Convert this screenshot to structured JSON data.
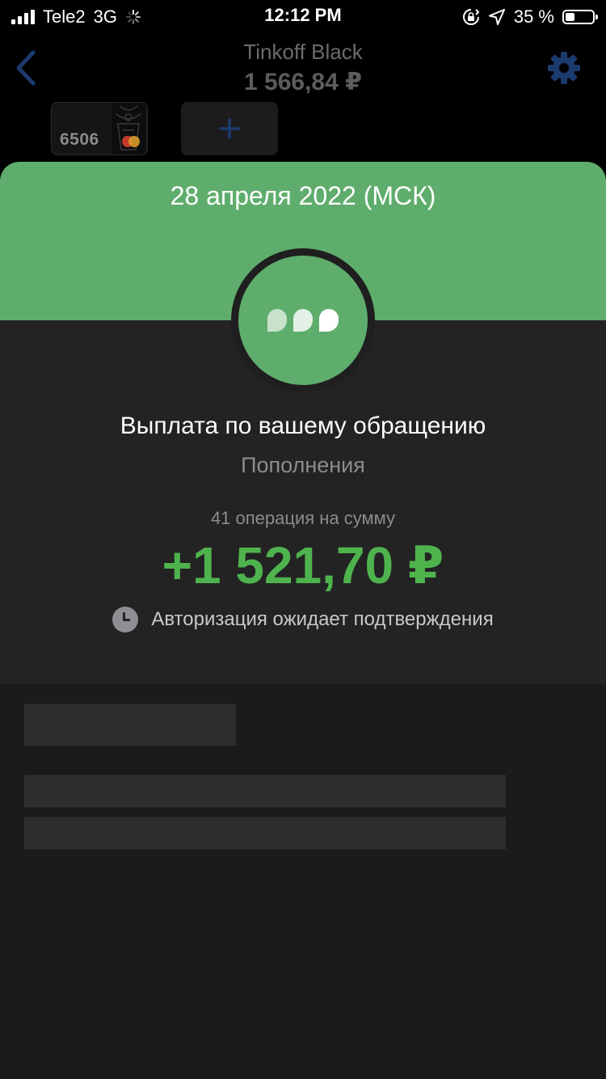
{
  "status_bar": {
    "carrier": "Tele2",
    "network": "3G",
    "time": "12:12 PM",
    "battery_text": "35 %",
    "battery_level": 0.35,
    "icons": [
      "signal-icon",
      "loading-spinner-icon",
      "orientation-lock-icon",
      "location-arrow-icon",
      "battery-icon"
    ]
  },
  "header": {
    "title": "Tinkoff Black",
    "balance": "1 566,84 ₽",
    "back_icon": "chevron-left-icon",
    "settings_icon": "gear-icon"
  },
  "cards": {
    "card_number": "6506",
    "card_brand_icon": "mastercard-icon",
    "add_icon": "plus-icon"
  },
  "operation": {
    "date": "28 апреля 2022 (МСК)",
    "category_icon": "chat-bubbles-icon",
    "title": "Выплата по вашему обращению",
    "category": "Пополнения",
    "count_text": "41 операция на сумму",
    "amount": "+1 521,70 ₽",
    "status_icon": "clock-icon",
    "status": "Авторизация ожидает подтверждения"
  },
  "colors": {
    "accent_green": "#5fad6c",
    "amount_green": "#4fb34d",
    "nav_blue": "#1c3a6e",
    "background": "#000000",
    "panel": "#232323"
  }
}
